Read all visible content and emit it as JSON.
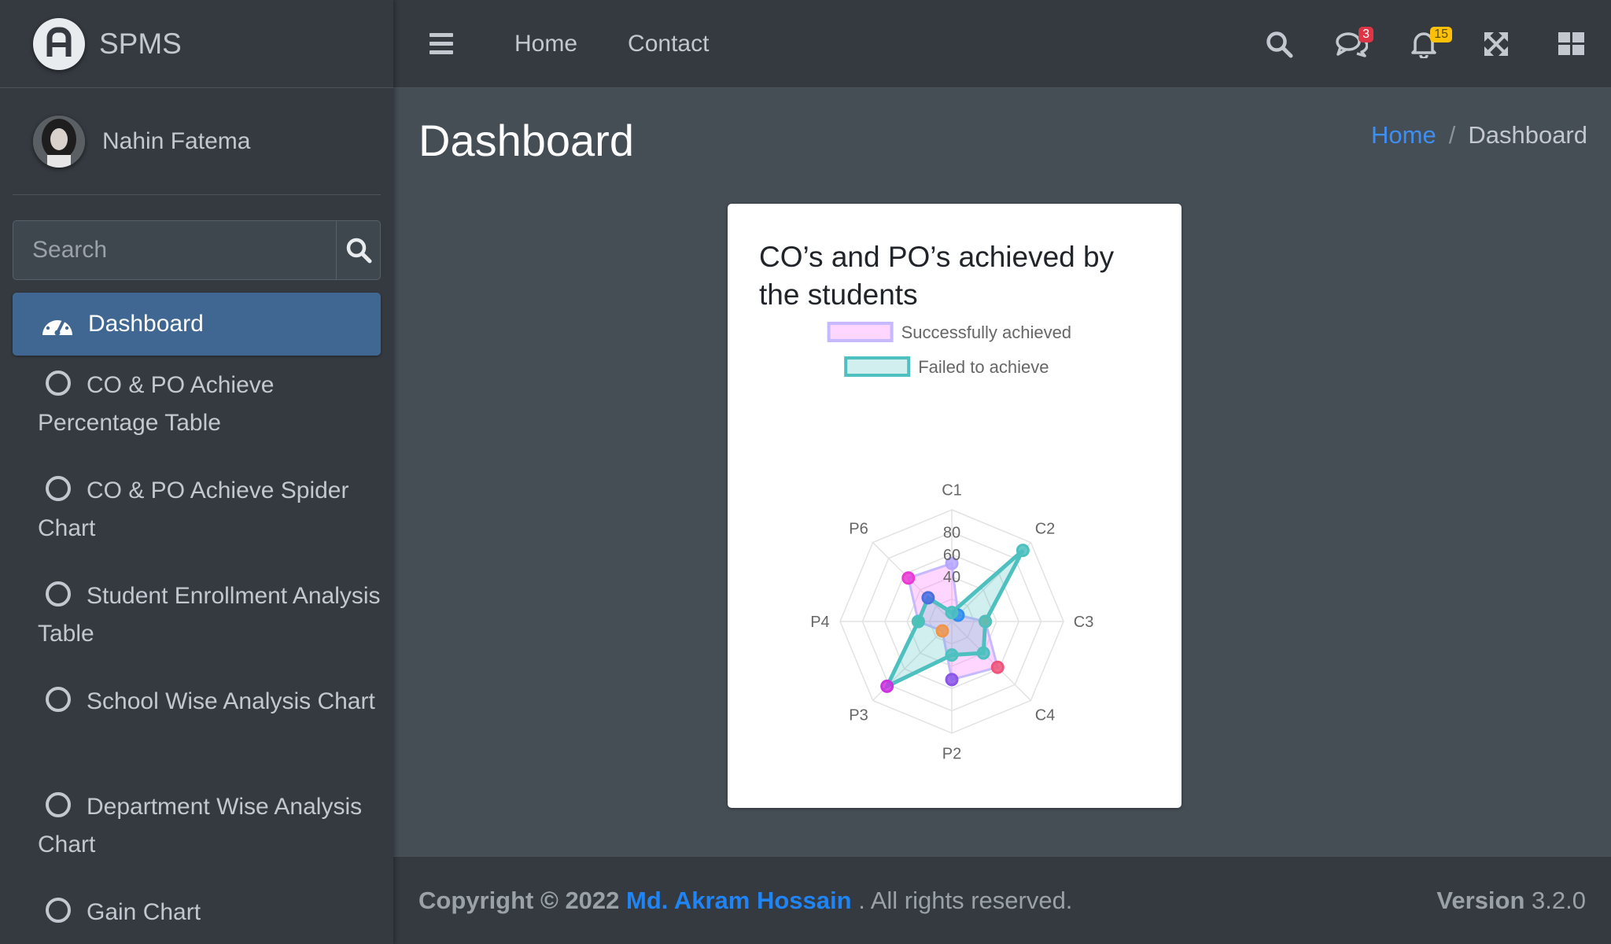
{
  "brand": {
    "name": "SPMS"
  },
  "user": {
    "name": "Nahin Fatema"
  },
  "search": {
    "placeholder": "Search"
  },
  "sidebar": {
    "items": [
      {
        "label": "Dashboard",
        "active": true
      },
      {
        "label": "CO & PO Achieve Percentage Table"
      },
      {
        "label": "CO & PO Achieve Spider Chart"
      },
      {
        "label": "Student Enrollment Analysis Table"
      },
      {
        "label": "School Wise Analysis Chart"
      },
      {
        "label": "Department Wise Analysis Chart"
      },
      {
        "label": "Gain Chart"
      }
    ]
  },
  "topbar": {
    "links": [
      "Home",
      "Contact"
    ],
    "messages_badge": "3",
    "notifications_badge": "15"
  },
  "header": {
    "title": "Dashboard"
  },
  "breadcrumb": {
    "home": "Home",
    "separator": "/",
    "current": "Dashboard"
  },
  "card": {
    "title": "CO’s and PO’s achieved by the students"
  },
  "chart_data": {
    "type": "radar",
    "title": "CO’s and PO’s achieved by the students",
    "labels": [
      "C1",
      "C2",
      "C3",
      "C4",
      "P2",
      "P3",
      "P4",
      "P6"
    ],
    "r_ticks": [
      "40",
      "60",
      "80"
    ],
    "r_range": [
      0,
      100
    ],
    "legend_position": "top",
    "series": [
      {
        "name": "Successfully achieved",
        "values": [
          52,
          8,
          30,
          58,
          52,
          12,
          30,
          55
        ],
        "fill": "rgba(255,120,255,0.3)",
        "border": "#c7b9ff",
        "point_colors": [
          "#b7a6ff",
          "#2f8ef0",
          "#f59f45",
          "#f0547a",
          "#8b55e8",
          "#f0954a",
          "#34c96b",
          "#ea3ad6"
        ]
      },
      {
        "name": "Failed to achieve",
        "values": [
          8,
          90,
          30,
          40,
          30,
          82,
          30,
          30
        ],
        "fill": "rgba(77,192,191,0.25)",
        "border": "#4dc0bf",
        "point_colors": [
          "#4dc0bf",
          "#4dc0bf",
          "#4dc0bf",
          "#4dc0bf",
          "#4dc0bf",
          "#cc33e0",
          "#4dc0bf",
          "#4a6fe0"
        ]
      }
    ]
  },
  "footer": {
    "copyright": "Copyright © 2022",
    "author": "Md. Akram Hossain",
    "suffix": ". All rights reserved.",
    "version_label": "Version",
    "version_value": "3.2.0"
  }
}
